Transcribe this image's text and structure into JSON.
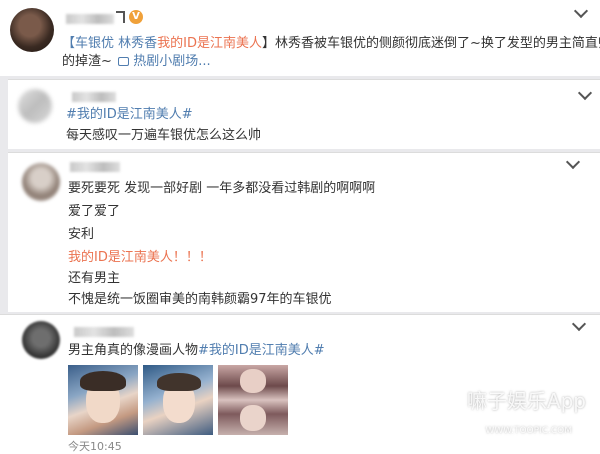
{
  "post": {
    "verified_badge": "V",
    "line1_tag": "【车银优 林秀香",
    "line1_link": "我的ID是江南美人",
    "line1_rest": "】林秀香被车银优的侧颜彻底迷倒了~换了发型的男主简直帅",
    "line2_text": "的掉渣~",
    "video_link": "热剧小剧场..."
  },
  "comment1": {
    "hashtag": "#我的ID是江南美人#",
    "text": "每天感叹一万遍车银优怎么这么帅"
  },
  "comment2": {
    "lines": [
      "要死要死 发现一部好剧 一年多都没看过韩剧的啊啊啊",
      "爱了爱了",
      "安利"
    ],
    "link_line": "我的ID是江南美人！！！",
    "lines2": [
      "还有男主",
      "不愧是统一饭圈审美的南韩颜霸97年的车银优"
    ]
  },
  "comment3": {
    "text": "男主角真的像漫画人物",
    "hashtag": "#我的ID是江南美人#",
    "time": "今天10:45"
  },
  "watermark": {
    "text": "嘛子娱乐App",
    "sub": "WWW.TOOPIC.COM"
  },
  "colors": {
    "link": "#eb7350",
    "hashtag": "#507daf",
    "background": "#e9e9ec"
  }
}
